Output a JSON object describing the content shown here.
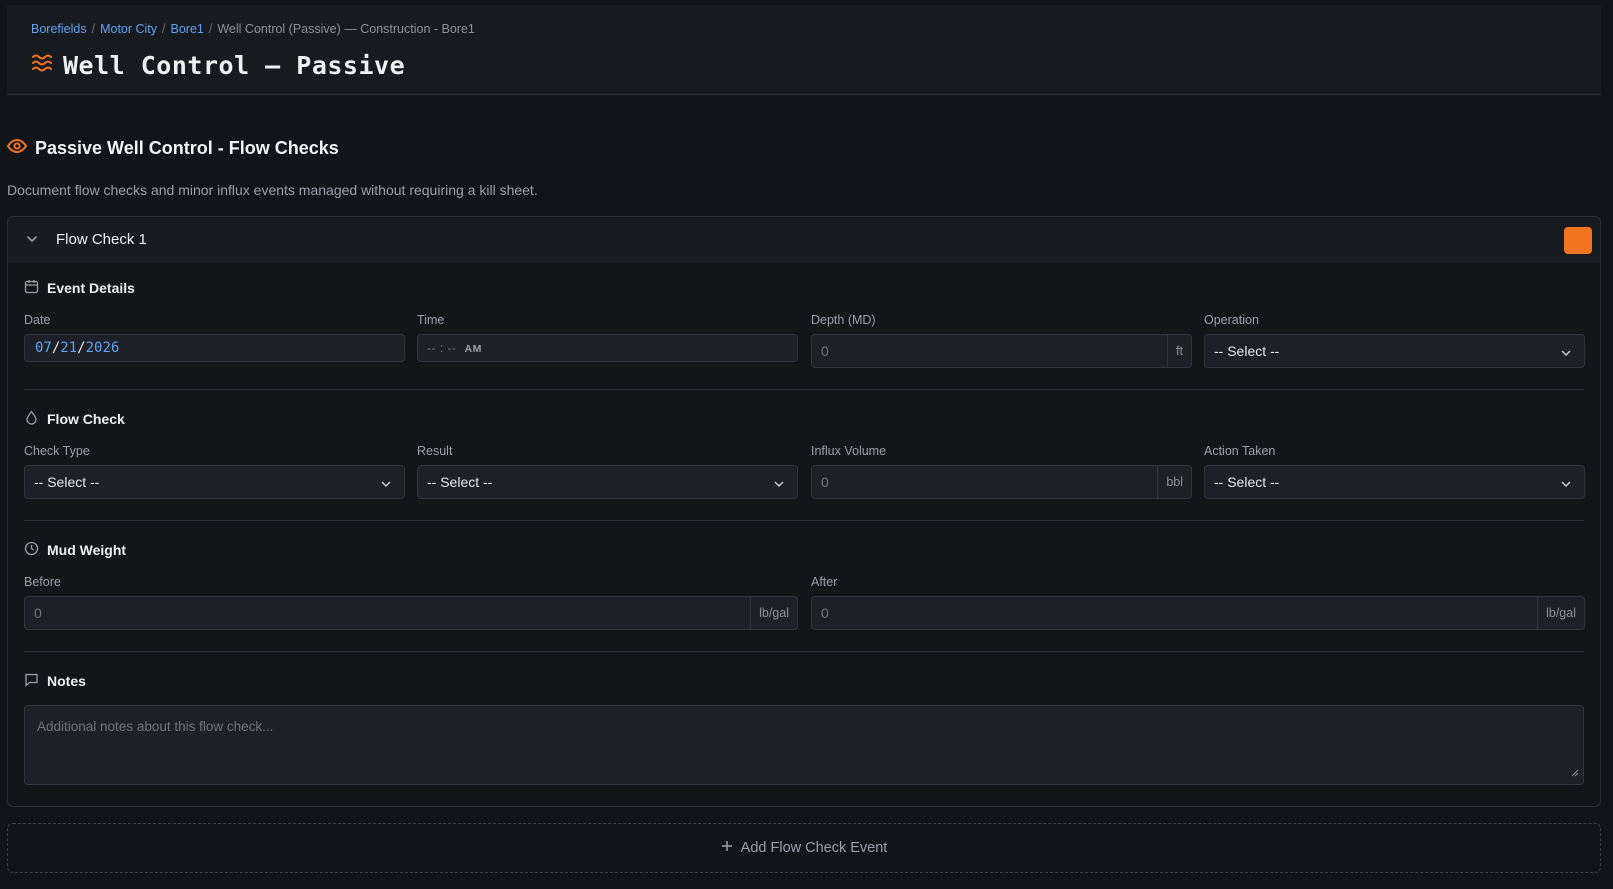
{
  "breadcrumb": {
    "items": [
      "Borefields",
      "Motor City",
      "Bore1"
    ],
    "separator": "/",
    "current": "Well Control (Passive) — Construction - Bore1"
  },
  "page": {
    "title": "Well Control — Passive",
    "accent": "#f47521",
    "link_color": "#5ea3f3"
  },
  "section": {
    "title": "Passive Well Control - Flow Checks",
    "description": "Document flow checks and minor influx events managed without requiring a kill sheet."
  },
  "card": {
    "title": "Flow Check 1",
    "event_details": {
      "title": "Event Details",
      "date": {
        "label": "Date",
        "month": "07",
        "day": "21",
        "year": "2026"
      },
      "time": {
        "label": "Time",
        "placeholder": "-- : --",
        "ampm": "AM"
      },
      "depth": {
        "label": "Depth (MD)",
        "placeholder": "0",
        "unit": "ft"
      },
      "operation": {
        "label": "Operation",
        "value": "-- Select --"
      }
    },
    "flow_check": {
      "title": "Flow Check",
      "check_type": {
        "label": "Check Type",
        "value": "-- Select --"
      },
      "result": {
        "label": "Result",
        "value": "-- Select --"
      },
      "influx_volume": {
        "label": "Influx Volume",
        "placeholder": "0",
        "unit": "bbl"
      },
      "action_taken": {
        "label": "Action Taken",
        "value": "-- Select --"
      }
    },
    "mud_weight": {
      "title": "Mud Weight",
      "before": {
        "label": "Before",
        "placeholder": "0",
        "unit": "lb/gal"
      },
      "after": {
        "label": "After",
        "placeholder": "0",
        "unit": "lb/gal"
      }
    },
    "notes": {
      "title": "Notes",
      "placeholder": "Additional notes about this flow check..."
    }
  },
  "add_button": {
    "label": "Add Flow Check Event"
  },
  "icons": {
    "title_icon": "waves-icon",
    "section_icon": "eye-icon",
    "event_icon": "calendar-icon",
    "flow_icon": "droplet-icon",
    "mud_icon": "gauge-icon",
    "notes_icon": "message-square-icon",
    "add_icon": "plus-icon"
  }
}
